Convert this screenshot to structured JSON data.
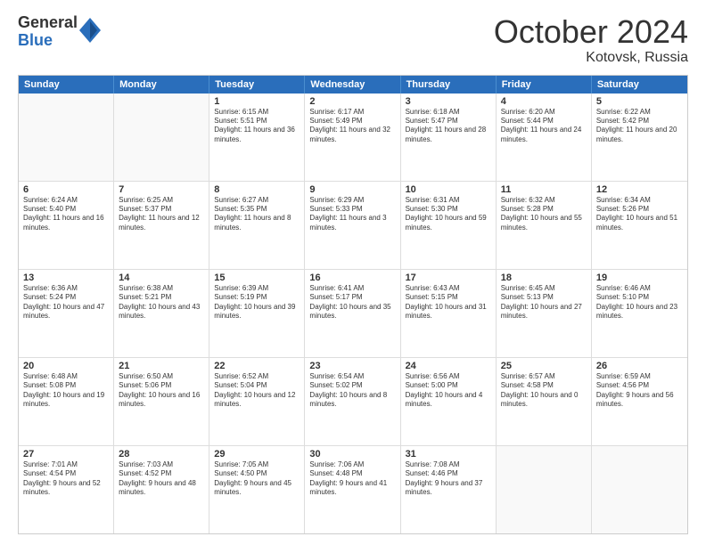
{
  "logo": {
    "general": "General",
    "blue": "Blue"
  },
  "header": {
    "month": "October 2024",
    "location": "Kotovsk, Russia"
  },
  "weekdays": [
    "Sunday",
    "Monday",
    "Tuesday",
    "Wednesday",
    "Thursday",
    "Friday",
    "Saturday"
  ],
  "weeks": [
    [
      {
        "day": "",
        "empty": true,
        "sunrise": "",
        "sunset": "",
        "daylight": ""
      },
      {
        "day": "",
        "empty": true,
        "sunrise": "",
        "sunset": "",
        "daylight": ""
      },
      {
        "day": "1",
        "sunrise": "Sunrise: 6:15 AM",
        "sunset": "Sunset: 5:51 PM",
        "daylight": "Daylight: 11 hours and 36 minutes."
      },
      {
        "day": "2",
        "sunrise": "Sunrise: 6:17 AM",
        "sunset": "Sunset: 5:49 PM",
        "daylight": "Daylight: 11 hours and 32 minutes."
      },
      {
        "day": "3",
        "sunrise": "Sunrise: 6:18 AM",
        "sunset": "Sunset: 5:47 PM",
        "daylight": "Daylight: 11 hours and 28 minutes."
      },
      {
        "day": "4",
        "sunrise": "Sunrise: 6:20 AM",
        "sunset": "Sunset: 5:44 PM",
        "daylight": "Daylight: 11 hours and 24 minutes."
      },
      {
        "day": "5",
        "sunrise": "Sunrise: 6:22 AM",
        "sunset": "Sunset: 5:42 PM",
        "daylight": "Daylight: 11 hours and 20 minutes."
      }
    ],
    [
      {
        "day": "6",
        "sunrise": "Sunrise: 6:24 AM",
        "sunset": "Sunset: 5:40 PM",
        "daylight": "Daylight: 11 hours and 16 minutes."
      },
      {
        "day": "7",
        "sunrise": "Sunrise: 6:25 AM",
        "sunset": "Sunset: 5:37 PM",
        "daylight": "Daylight: 11 hours and 12 minutes."
      },
      {
        "day": "8",
        "sunrise": "Sunrise: 6:27 AM",
        "sunset": "Sunset: 5:35 PM",
        "daylight": "Daylight: 11 hours and 8 minutes."
      },
      {
        "day": "9",
        "sunrise": "Sunrise: 6:29 AM",
        "sunset": "Sunset: 5:33 PM",
        "daylight": "Daylight: 11 hours and 3 minutes."
      },
      {
        "day": "10",
        "sunrise": "Sunrise: 6:31 AM",
        "sunset": "Sunset: 5:30 PM",
        "daylight": "Daylight: 10 hours and 59 minutes."
      },
      {
        "day": "11",
        "sunrise": "Sunrise: 6:32 AM",
        "sunset": "Sunset: 5:28 PM",
        "daylight": "Daylight: 10 hours and 55 minutes."
      },
      {
        "day": "12",
        "sunrise": "Sunrise: 6:34 AM",
        "sunset": "Sunset: 5:26 PM",
        "daylight": "Daylight: 10 hours and 51 minutes."
      }
    ],
    [
      {
        "day": "13",
        "sunrise": "Sunrise: 6:36 AM",
        "sunset": "Sunset: 5:24 PM",
        "daylight": "Daylight: 10 hours and 47 minutes."
      },
      {
        "day": "14",
        "sunrise": "Sunrise: 6:38 AM",
        "sunset": "Sunset: 5:21 PM",
        "daylight": "Daylight: 10 hours and 43 minutes."
      },
      {
        "day": "15",
        "sunrise": "Sunrise: 6:39 AM",
        "sunset": "Sunset: 5:19 PM",
        "daylight": "Daylight: 10 hours and 39 minutes."
      },
      {
        "day": "16",
        "sunrise": "Sunrise: 6:41 AM",
        "sunset": "Sunset: 5:17 PM",
        "daylight": "Daylight: 10 hours and 35 minutes."
      },
      {
        "day": "17",
        "sunrise": "Sunrise: 6:43 AM",
        "sunset": "Sunset: 5:15 PM",
        "daylight": "Daylight: 10 hours and 31 minutes."
      },
      {
        "day": "18",
        "sunrise": "Sunrise: 6:45 AM",
        "sunset": "Sunset: 5:13 PM",
        "daylight": "Daylight: 10 hours and 27 minutes."
      },
      {
        "day": "19",
        "sunrise": "Sunrise: 6:46 AM",
        "sunset": "Sunset: 5:10 PM",
        "daylight": "Daylight: 10 hours and 23 minutes."
      }
    ],
    [
      {
        "day": "20",
        "sunrise": "Sunrise: 6:48 AM",
        "sunset": "Sunset: 5:08 PM",
        "daylight": "Daylight: 10 hours and 19 minutes."
      },
      {
        "day": "21",
        "sunrise": "Sunrise: 6:50 AM",
        "sunset": "Sunset: 5:06 PM",
        "daylight": "Daylight: 10 hours and 16 minutes."
      },
      {
        "day": "22",
        "sunrise": "Sunrise: 6:52 AM",
        "sunset": "Sunset: 5:04 PM",
        "daylight": "Daylight: 10 hours and 12 minutes."
      },
      {
        "day": "23",
        "sunrise": "Sunrise: 6:54 AM",
        "sunset": "Sunset: 5:02 PM",
        "daylight": "Daylight: 10 hours and 8 minutes."
      },
      {
        "day": "24",
        "sunrise": "Sunrise: 6:56 AM",
        "sunset": "Sunset: 5:00 PM",
        "daylight": "Daylight: 10 hours and 4 minutes."
      },
      {
        "day": "25",
        "sunrise": "Sunrise: 6:57 AM",
        "sunset": "Sunset: 4:58 PM",
        "daylight": "Daylight: 10 hours and 0 minutes."
      },
      {
        "day": "26",
        "sunrise": "Sunrise: 6:59 AM",
        "sunset": "Sunset: 4:56 PM",
        "daylight": "Daylight: 9 hours and 56 minutes."
      }
    ],
    [
      {
        "day": "27",
        "sunrise": "Sunrise: 7:01 AM",
        "sunset": "Sunset: 4:54 PM",
        "daylight": "Daylight: 9 hours and 52 minutes."
      },
      {
        "day": "28",
        "sunrise": "Sunrise: 7:03 AM",
        "sunset": "Sunset: 4:52 PM",
        "daylight": "Daylight: 9 hours and 48 minutes."
      },
      {
        "day": "29",
        "sunrise": "Sunrise: 7:05 AM",
        "sunset": "Sunset: 4:50 PM",
        "daylight": "Daylight: 9 hours and 45 minutes."
      },
      {
        "day": "30",
        "sunrise": "Sunrise: 7:06 AM",
        "sunset": "Sunset: 4:48 PM",
        "daylight": "Daylight: 9 hours and 41 minutes."
      },
      {
        "day": "31",
        "sunrise": "Sunrise: 7:08 AM",
        "sunset": "Sunset: 4:46 PM",
        "daylight": "Daylight: 9 hours and 37 minutes."
      },
      {
        "day": "",
        "empty": true,
        "sunrise": "",
        "sunset": "",
        "daylight": ""
      },
      {
        "day": "",
        "empty": true,
        "sunrise": "",
        "sunset": "",
        "daylight": ""
      }
    ]
  ]
}
